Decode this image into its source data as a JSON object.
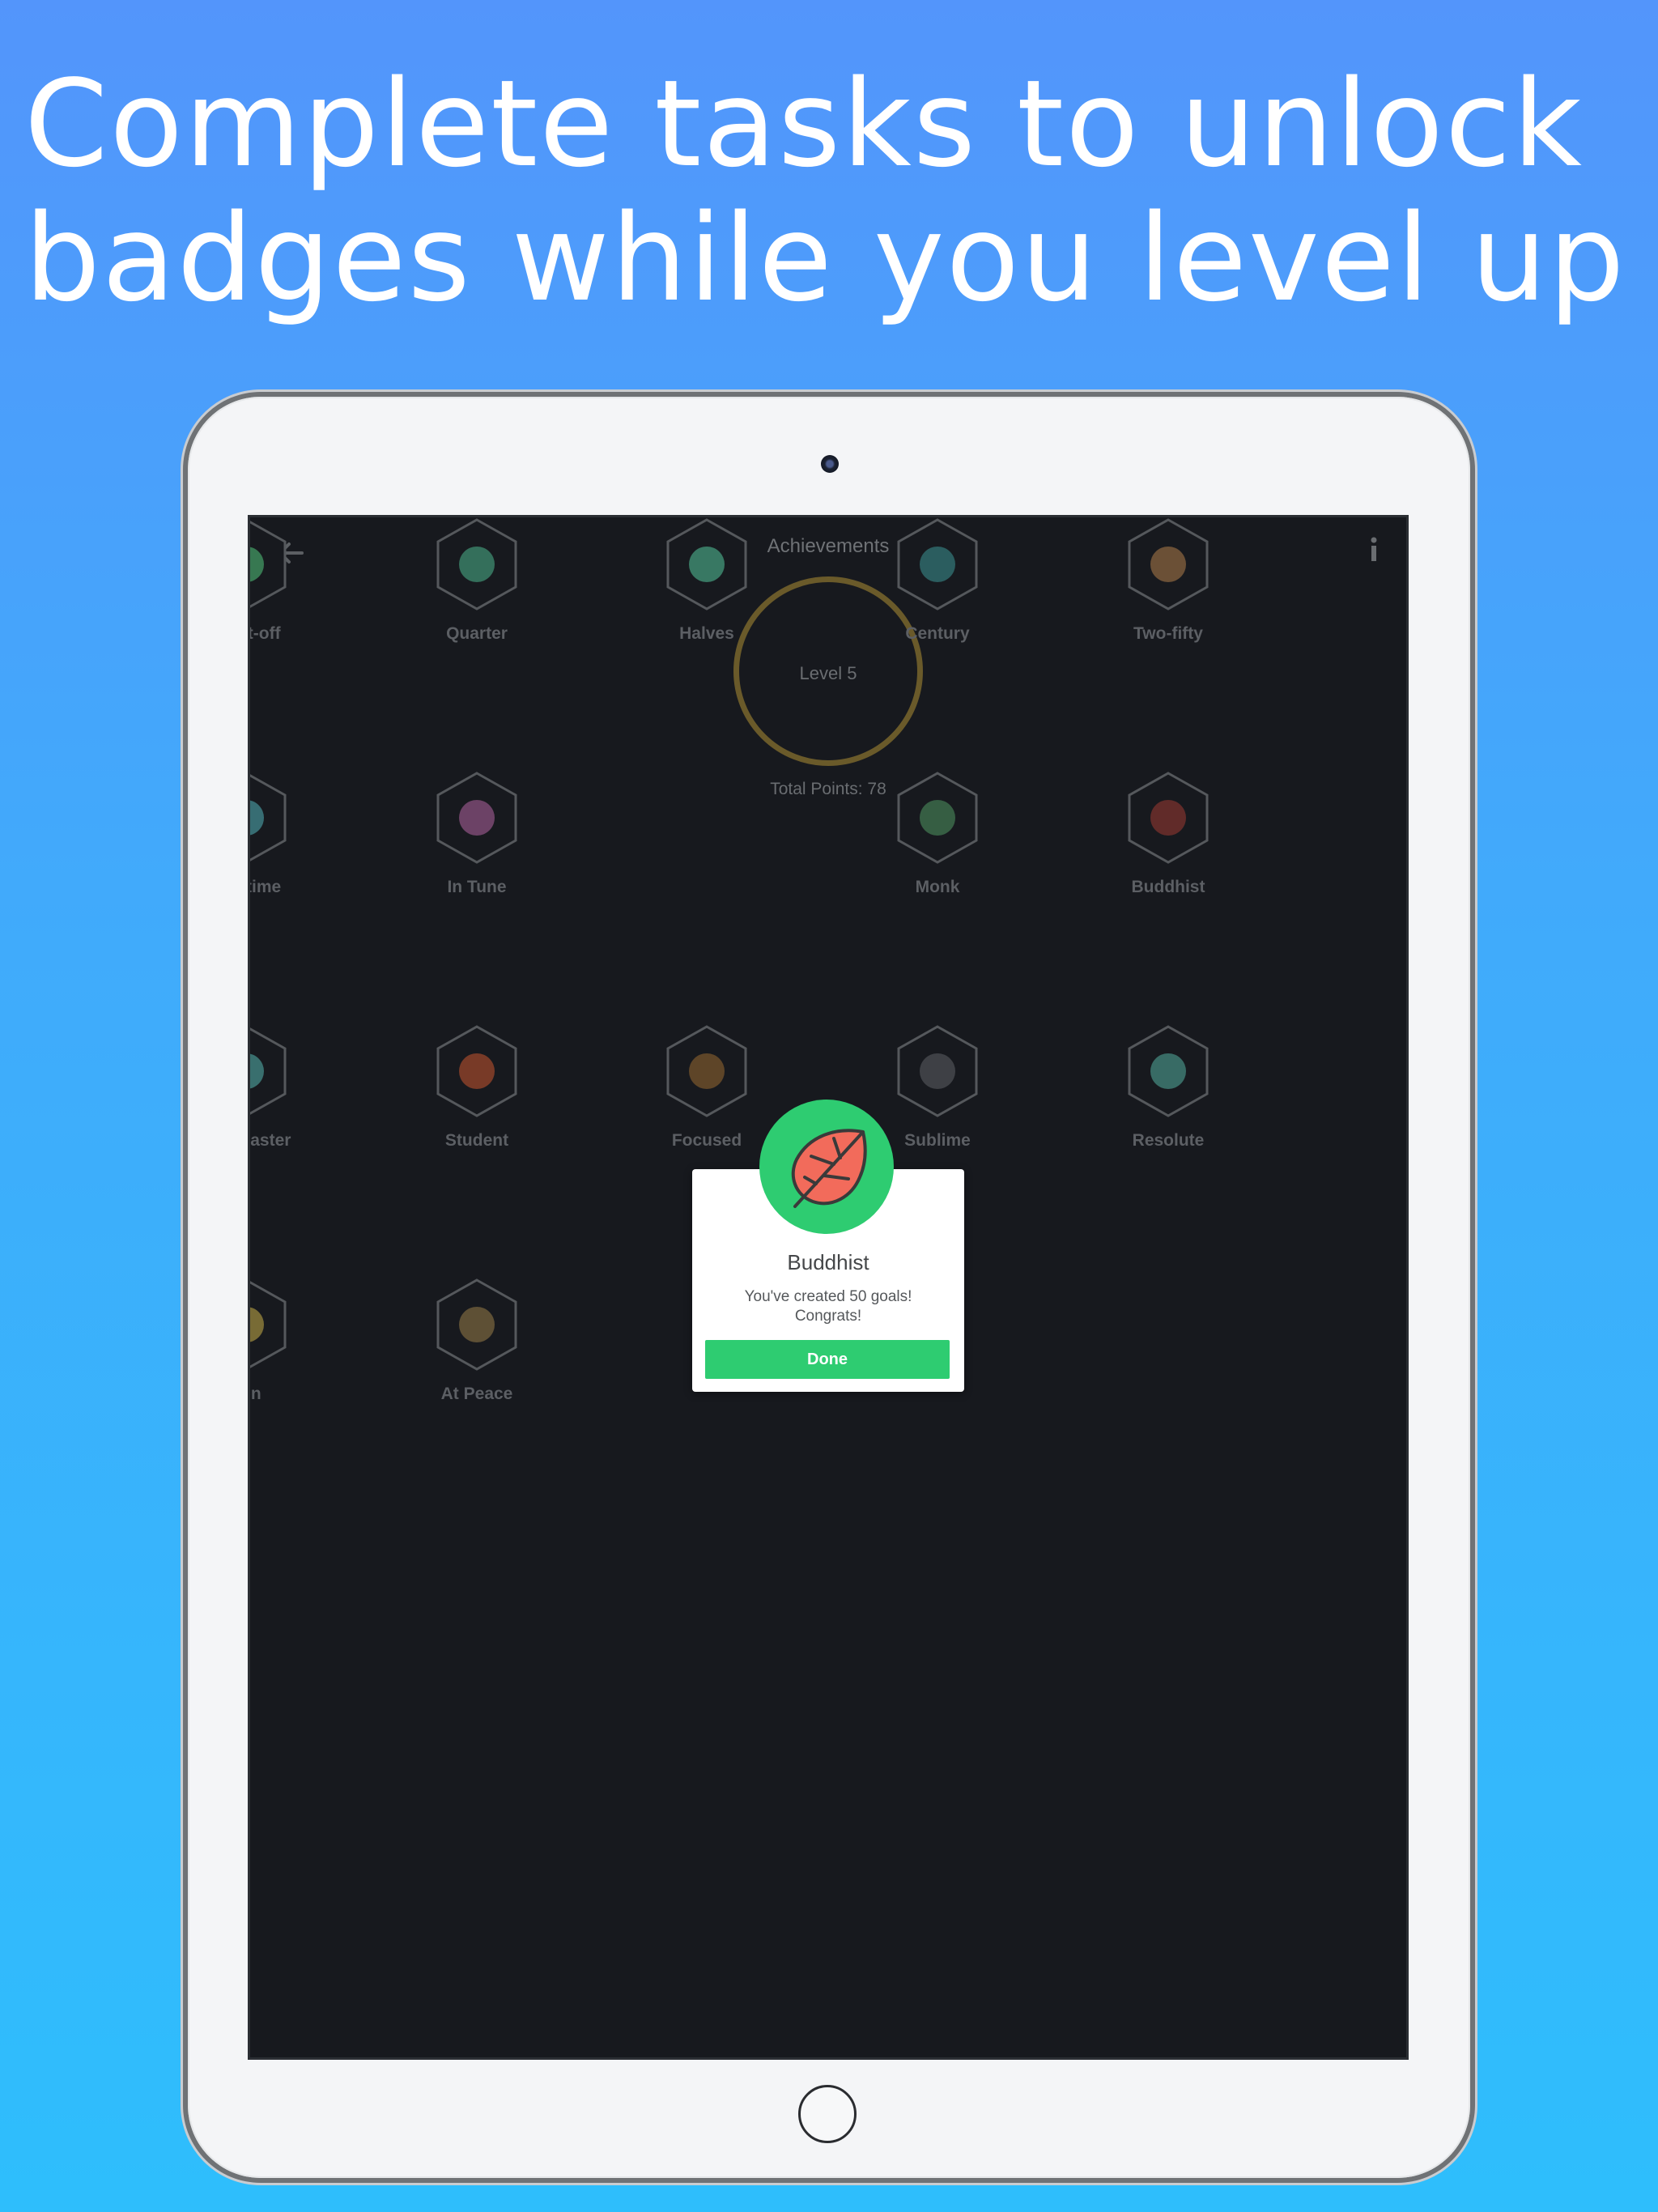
{
  "headline": {
    "line1": "Complete tasks to unlock",
    "line2": "badges while you level up"
  },
  "nav": {
    "title": "Achievements",
    "back_icon": "arrow-left-icon",
    "info_icon": "info-icon"
  },
  "level": {
    "label": "Level 5",
    "total_points": "Total Points: 78",
    "ring_color": "#6a5a2a"
  },
  "badges": [
    {
      "label": "Blast-off",
      "icon": "d20-dice-icon"
    },
    {
      "label": "Quarter",
      "icon": "dice-globe-icon"
    },
    {
      "label": "Halves",
      "icon": "satellite-icon"
    },
    {
      "label": "Century",
      "icon": "leaf-quill-icon"
    },
    {
      "label": "Two-fifty",
      "icon": "dots-circle-icon"
    },
    {
      "label": "Playtime",
      "icon": "cloud-icon"
    },
    {
      "label": "In Tune",
      "icon": "calculator-icon"
    },
    {
      "label": "Monk",
      "icon": "star-book-icon"
    },
    {
      "label": "Buddhist",
      "icon": "leaf-icon"
    },
    {
      "label": "Zen Master",
      "icon": "diamond-icon"
    },
    {
      "label": "Student",
      "icon": "basketball-icon"
    },
    {
      "label": "Focused",
      "icon": "books-icon"
    },
    {
      "label": "Sublime",
      "icon": "fountain-pen-icon"
    },
    {
      "label": "Resolute",
      "icon": "paintbrush-icon"
    },
    {
      "label": "Zen",
      "icon": "dot-icon"
    },
    {
      "label": "At Peace",
      "icon": "scale-icon"
    }
  ],
  "dialog": {
    "title": "Buddhist",
    "message_line1": "You've created 50 goals!",
    "message_line2": "Congrats!",
    "button": "Done",
    "icon": "leaf-icon",
    "accent": "#2ecc71",
    "leaf_color": "#f26b5b"
  }
}
